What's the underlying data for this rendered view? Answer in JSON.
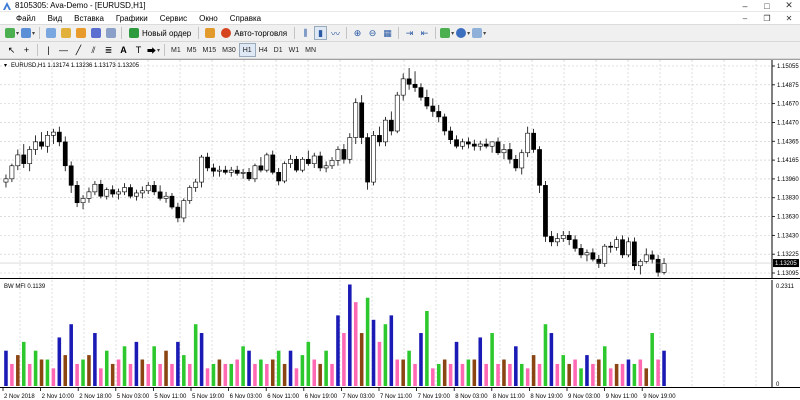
{
  "window": {
    "title": "8105305: Ava-Demo - [EURUSD,H1]"
  },
  "menu": [
    "Файл",
    "Вид",
    "Вставка",
    "Графики",
    "Сервис",
    "Окно",
    "Справка"
  ],
  "toolbar": {
    "new_order_label": "Новый ордер",
    "autotrading_label": "Авто-торговля",
    "timeframes": [
      "M1",
      "M5",
      "M15",
      "M30",
      "H1",
      "H4",
      "D1",
      "W1",
      "MN"
    ],
    "active_timeframe": "H1"
  },
  "main_chart": {
    "header": "EURUSD,H1  1.13174 1.13236 1.13173 1.13205",
    "price_ticks": [
      "1.15055",
      "1.14875",
      "1.14670",
      "1.14470",
      "1.14365",
      "1.14165",
      "1.13960",
      "1.13830",
      "1.13630",
      "1.13430",
      "1.13225",
      "1.13095"
    ],
    "current_price": "1.13205",
    "current_price_color": "#000000"
  },
  "indicator": {
    "header": "BW MFI 0.1139",
    "scale_top": "0.2311",
    "scale_bottom": "0",
    "colors": {
      "green": "#2dc82d",
      "blue": "#1a1ab4",
      "brown": "#8b4513",
      "pink": "#ff69b4"
    }
  },
  "time_axis": [
    "2 Nov 2018",
    "2 Nov 10:00",
    "2 Nov 18:00",
    "5 Nov 03:00",
    "5 Nov 11:00",
    "5 Nov 19:00",
    "6 Nov 03:00",
    "6 Nov 11:00",
    "6 Nov 19:00",
    "7 Nov 03:00",
    "7 Nov 11:00",
    "7 Nov 19:00",
    "8 Nov 03:00",
    "8 Nov 11:00",
    "8 Nov 19:00",
    "9 Nov 03:00",
    "9 Nov 11:00",
    "9 Nov 19:00"
  ],
  "chart_data": {
    "type": "candlestick",
    "ylim": [
      1.13095,
      1.15055
    ],
    "candles": [
      [
        1.1395,
        1.1402,
        1.139,
        1.1398
      ],
      [
        1.1398,
        1.1412,
        1.1395,
        1.141
      ],
      [
        1.141,
        1.1425,
        1.1406,
        1.142
      ],
      [
        1.142,
        1.143,
        1.1408,
        1.1412
      ],
      [
        1.1412,
        1.1428,
        1.1405,
        1.1425
      ],
      [
        1.1425,
        1.1438,
        1.142,
        1.1432
      ],
      [
        1.1432,
        1.1441,
        1.1425,
        1.1428
      ],
      [
        1.1428,
        1.1442,
        1.1422,
        1.1438
      ],
      [
        1.1438,
        1.1444,
        1.143,
        1.1441
      ],
      [
        1.1441,
        1.1446,
        1.1428,
        1.1432
      ],
      [
        1.1432,
        1.1437,
        1.1405,
        1.141
      ],
      [
        1.141,
        1.1414,
        1.1385,
        1.1392
      ],
      [
        1.1392,
        1.1396,
        1.1372,
        1.1376
      ],
      [
        1.1376,
        1.1383,
        1.137,
        1.138
      ],
      [
        1.138,
        1.139,
        1.1376,
        1.1386
      ],
      [
        1.1386,
        1.1396,
        1.1383,
        1.1393
      ],
      [
        1.1393,
        1.1397,
        1.138,
        1.1382
      ],
      [
        1.1382,
        1.139,
        1.1379,
        1.1388
      ],
      [
        1.1388,
        1.1392,
        1.1381,
        1.1384
      ],
      [
        1.1384,
        1.1389,
        1.1379,
        1.1386
      ],
      [
        1.1386,
        1.1394,
        1.1383,
        1.139
      ],
      [
        1.139,
        1.1393,
        1.138,
        1.1382
      ],
      [
        1.1382,
        1.1388,
        1.1378,
        1.1385
      ],
      [
        1.1385,
        1.1391,
        1.138,
        1.1387
      ],
      [
        1.1387,
        1.1395,
        1.1384,
        1.1392
      ],
      [
        1.1392,
        1.1396,
        1.1383,
        1.1386
      ],
      [
        1.1386,
        1.1392,
        1.1378,
        1.138
      ],
      [
        1.138,
        1.1386,
        1.1376,
        1.1382
      ],
      [
        1.1382,
        1.1385,
        1.137,
        1.1372
      ],
      [
        1.1372,
        1.1376,
        1.1358,
        1.1362
      ],
      [
        1.1362,
        1.138,
        1.1358,
        1.1378
      ],
      [
        1.1378,
        1.1392,
        1.1375,
        1.139
      ],
      [
        1.139,
        1.1398,
        1.1386,
        1.1395
      ],
      [
        1.1395,
        1.142,
        1.139,
        1.1418
      ],
      [
        1.1418,
        1.1422,
        1.1405,
        1.1408
      ],
      [
        1.1408,
        1.1412,
        1.14,
        1.1405
      ],
      [
        1.1405,
        1.141,
        1.14,
        1.1406
      ],
      [
        1.1406,
        1.141,
        1.1402,
        1.1404
      ],
      [
        1.1404,
        1.1409,
        1.14,
        1.1406
      ],
      [
        1.1406,
        1.141,
        1.1401,
        1.1403
      ],
      [
        1.1403,
        1.1407,
        1.1398,
        1.1404
      ],
      [
        1.1404,
        1.1408,
        1.1396,
        1.1398
      ],
      [
        1.1398,
        1.1412,
        1.1395,
        1.141
      ],
      [
        1.141,
        1.1418,
        1.1404,
        1.1406
      ],
      [
        1.1406,
        1.1422,
        1.1404,
        1.142
      ],
      [
        1.142,
        1.1424,
        1.1402,
        1.1404
      ],
      [
        1.1404,
        1.1408,
        1.1392,
        1.1396
      ],
      [
        1.1396,
        1.1414,
        1.1394,
        1.1412
      ],
      [
        1.1412,
        1.142,
        1.1408,
        1.1416
      ],
      [
        1.1416,
        1.1419,
        1.1404,
        1.1406
      ],
      [
        1.1406,
        1.1418,
        1.1404,
        1.1416
      ],
      [
        1.1416,
        1.1424,
        1.141,
        1.1412
      ],
      [
        1.1412,
        1.1422,
        1.1408,
        1.1419
      ],
      [
        1.1419,
        1.1423,
        1.1405,
        1.1408
      ],
      [
        1.1408,
        1.1414,
        1.1404,
        1.141
      ],
      [
        1.141,
        1.1418,
        1.1407,
        1.1415
      ],
      [
        1.1415,
        1.1428,
        1.141,
        1.1425
      ],
      [
        1.1425,
        1.143,
        1.1412,
        1.1416
      ],
      [
        1.1416,
        1.144,
        1.1412,
        1.1436
      ],
      [
        1.1436,
        1.1472,
        1.143,
        1.1468
      ],
      [
        1.1468,
        1.1475,
        1.143,
        1.1436
      ],
      [
        1.1436,
        1.144,
        1.1388,
        1.1395
      ],
      [
        1.1395,
        1.1442,
        1.1392,
        1.1438
      ],
      [
        1.1438,
        1.1446,
        1.1428,
        1.1432
      ],
      [
        1.1432,
        1.1455,
        1.1428,
        1.1452
      ],
      [
        1.1452,
        1.146,
        1.1438,
        1.1442
      ],
      [
        1.1442,
        1.1478,
        1.144,
        1.1475
      ],
      [
        1.1475,
        1.1495,
        1.147,
        1.149
      ],
      [
        1.149,
        1.15,
        1.148,
        1.1485
      ],
      [
        1.1485,
        1.1497,
        1.1478,
        1.1482
      ],
      [
        1.1482,
        1.1486,
        1.147,
        1.1473
      ],
      [
        1.1473,
        1.148,
        1.1462,
        1.1465
      ],
      [
        1.1465,
        1.1472,
        1.1455,
        1.146
      ],
      [
        1.146,
        1.1466,
        1.145,
        1.1455
      ],
      [
        1.1455,
        1.1458,
        1.1438,
        1.1442
      ],
      [
        1.1442,
        1.1446,
        1.143,
        1.1434
      ],
      [
        1.1434,
        1.1438,
        1.1426,
        1.1428
      ],
      [
        1.1428,
        1.1435,
        1.1425,
        1.1432
      ],
      [
        1.1432,
        1.1436,
        1.1426,
        1.143
      ],
      [
        1.143,
        1.1434,
        1.1424,
        1.1428
      ],
      [
        1.1428,
        1.1433,
        1.1424,
        1.143
      ],
      [
        1.143,
        1.1435,
        1.1426,
        1.1428
      ],
      [
        1.1428,
        1.1432,
        1.1422,
        1.1432
      ],
      [
        1.1432,
        1.1436,
        1.142,
        1.1422
      ],
      [
        1.1422,
        1.143,
        1.1416,
        1.1425
      ],
      [
        1.1425,
        1.1431,
        1.1412,
        1.1416
      ],
      [
        1.1416,
        1.142,
        1.1405,
        1.1408
      ],
      [
        1.1408,
        1.1425,
        1.1402,
        1.1422
      ],
      [
        1.1422,
        1.1446,
        1.1418,
        1.144
      ],
      [
        1.144,
        1.1444,
        1.1422,
        1.1425
      ],
      [
        1.1425,
        1.1428,
        1.1385,
        1.1392
      ],
      [
        1.1392,
        1.1396,
        1.134,
        1.1345
      ],
      [
        1.1345,
        1.135,
        1.1336,
        1.134
      ],
      [
        1.134,
        1.1348,
        1.1336,
        1.1343
      ],
      [
        1.1343,
        1.135,
        1.134,
        1.1346
      ],
      [
        1.1346,
        1.135,
        1.1337,
        1.1342
      ],
      [
        1.1342,
        1.1346,
        1.1331,
        1.1334
      ],
      [
        1.1334,
        1.1338,
        1.1325,
        1.1328
      ],
      [
        1.1328,
        1.1333,
        1.1322,
        1.133
      ],
      [
        1.133,
        1.1334,
        1.1322,
        1.1324
      ],
      [
        1.1324,
        1.1328,
        1.1316,
        1.132
      ],
      [
        1.132,
        1.1338,
        1.1317,
        1.1336
      ],
      [
        1.1336,
        1.134,
        1.133,
        1.1335
      ],
      [
        1.1335,
        1.1345,
        1.1332,
        1.1342
      ],
      [
        1.1342,
        1.1346,
        1.1325,
        1.1328
      ],
      [
        1.1328,
        1.1344,
        1.1326,
        1.134
      ],
      [
        1.134,
        1.1344,
        1.1314,
        1.1318
      ],
      [
        1.1318,
        1.1324,
        1.131,
        1.1322
      ],
      [
        1.1322,
        1.1334,
        1.132,
        1.1328
      ],
      [
        1.1328,
        1.1332,
        1.132,
        1.1324
      ],
      [
        1.1324,
        1.1328,
        1.1308,
        1.1312
      ],
      [
        1.1312,
        1.1325,
        1.131,
        1.132
      ]
    ],
    "mfi_bars": [
      [
        "blue",
        0.08
      ],
      [
        "pink",
        0.05
      ],
      [
        "brown",
        0.07
      ],
      [
        "green",
        0.1
      ],
      [
        "pink",
        0.05
      ],
      [
        "green",
        0.08
      ],
      [
        "brown",
        0.06
      ],
      [
        "green",
        0.06
      ],
      [
        "pink",
        0.04
      ],
      [
        "blue",
        0.11
      ],
      [
        "brown",
        0.07
      ],
      [
        "blue",
        0.14
      ],
      [
        "pink",
        0.05
      ],
      [
        "green",
        0.06
      ],
      [
        "brown",
        0.07
      ],
      [
        "blue",
        0.12
      ],
      [
        "pink",
        0.04
      ],
      [
        "green",
        0.08
      ],
      [
        "brown",
        0.05
      ],
      [
        "pink",
        0.06
      ],
      [
        "green",
        0.09
      ],
      [
        "pink",
        0.05
      ],
      [
        "blue",
        0.1
      ],
      [
        "brown",
        0.06
      ],
      [
        "pink",
        0.05
      ],
      [
        "green",
        0.09
      ],
      [
        "pink",
        0.05
      ],
      [
        "brown",
        0.08
      ],
      [
        "pink",
        0.05
      ],
      [
        "blue",
        0.1
      ],
      [
        "green",
        0.07
      ],
      [
        "pink",
        0.05
      ],
      [
        "green",
        0.14
      ],
      [
        "blue",
        0.12
      ],
      [
        "pink",
        0.04
      ],
      [
        "green",
        0.05
      ],
      [
        "brown",
        0.06
      ],
      [
        "pink",
        0.05
      ],
      [
        "green",
        0.05
      ],
      [
        "pink",
        0.06
      ],
      [
        "green",
        0.09
      ],
      [
        "blue",
        0.08
      ],
      [
        "pink",
        0.05
      ],
      [
        "green",
        0.06
      ],
      [
        "pink",
        0.05
      ],
      [
        "brown",
        0.06
      ],
      [
        "green",
        0.08
      ],
      [
        "brown",
        0.05
      ],
      [
        "blue",
        0.08
      ],
      [
        "pink",
        0.04
      ],
      [
        "green",
        0.07
      ],
      [
        "green",
        0.1
      ],
      [
        "pink",
        0.06
      ],
      [
        "brown",
        0.05
      ],
      [
        "green",
        0.08
      ],
      [
        "pink",
        0.05
      ],
      [
        "blue",
        0.16
      ],
      [
        "pink",
        0.12
      ],
      [
        "blue",
        0.23
      ],
      [
        "pink",
        0.19
      ],
      [
        "brown",
        0.12
      ],
      [
        "green",
        0.2
      ],
      [
        "blue",
        0.15
      ],
      [
        "pink",
        0.1
      ],
      [
        "green",
        0.14
      ],
      [
        "blue",
        0.16
      ],
      [
        "pink",
        0.06
      ],
      [
        "brown",
        0.06
      ],
      [
        "green",
        0.08
      ],
      [
        "pink",
        0.05
      ],
      [
        "blue",
        0.12
      ],
      [
        "green",
        0.17
      ],
      [
        "pink",
        0.04
      ],
      [
        "green",
        0.05
      ],
      [
        "brown",
        0.06
      ],
      [
        "pink",
        0.05
      ],
      [
        "blue",
        0.1
      ],
      [
        "pink",
        0.05
      ],
      [
        "green",
        0.06
      ],
      [
        "brown",
        0.06
      ],
      [
        "blue",
        0.11
      ],
      [
        "pink",
        0.05
      ],
      [
        "green",
        0.12
      ],
      [
        "pink",
        0.05
      ],
      [
        "brown",
        0.06
      ],
      [
        "pink",
        0.05
      ],
      [
        "blue",
        0.09
      ],
      [
        "green",
        0.05
      ],
      [
        "pink",
        0.04
      ],
      [
        "brown",
        0.07
      ],
      [
        "pink",
        0.05
      ],
      [
        "green",
        0.14
      ],
      [
        "blue",
        0.12
      ],
      [
        "pink",
        0.05
      ],
      [
        "green",
        0.07
      ],
      [
        "brown",
        0.05
      ],
      [
        "pink",
        0.06
      ],
      [
        "green",
        0.04
      ],
      [
        "blue",
        0.07
      ],
      [
        "pink",
        0.05
      ],
      [
        "brown",
        0.06
      ],
      [
        "green",
        0.09
      ],
      [
        "pink",
        0.04
      ],
      [
        "brown",
        0.05
      ],
      [
        "pink",
        0.05
      ],
      [
        "blue",
        0.06
      ],
      [
        "green",
        0.05
      ],
      [
        "pink",
        0.06
      ],
      [
        "brown",
        0.04
      ],
      [
        "green",
        0.12
      ],
      [
        "pink",
        0.06
      ],
      [
        "blue",
        0.08
      ]
    ]
  }
}
